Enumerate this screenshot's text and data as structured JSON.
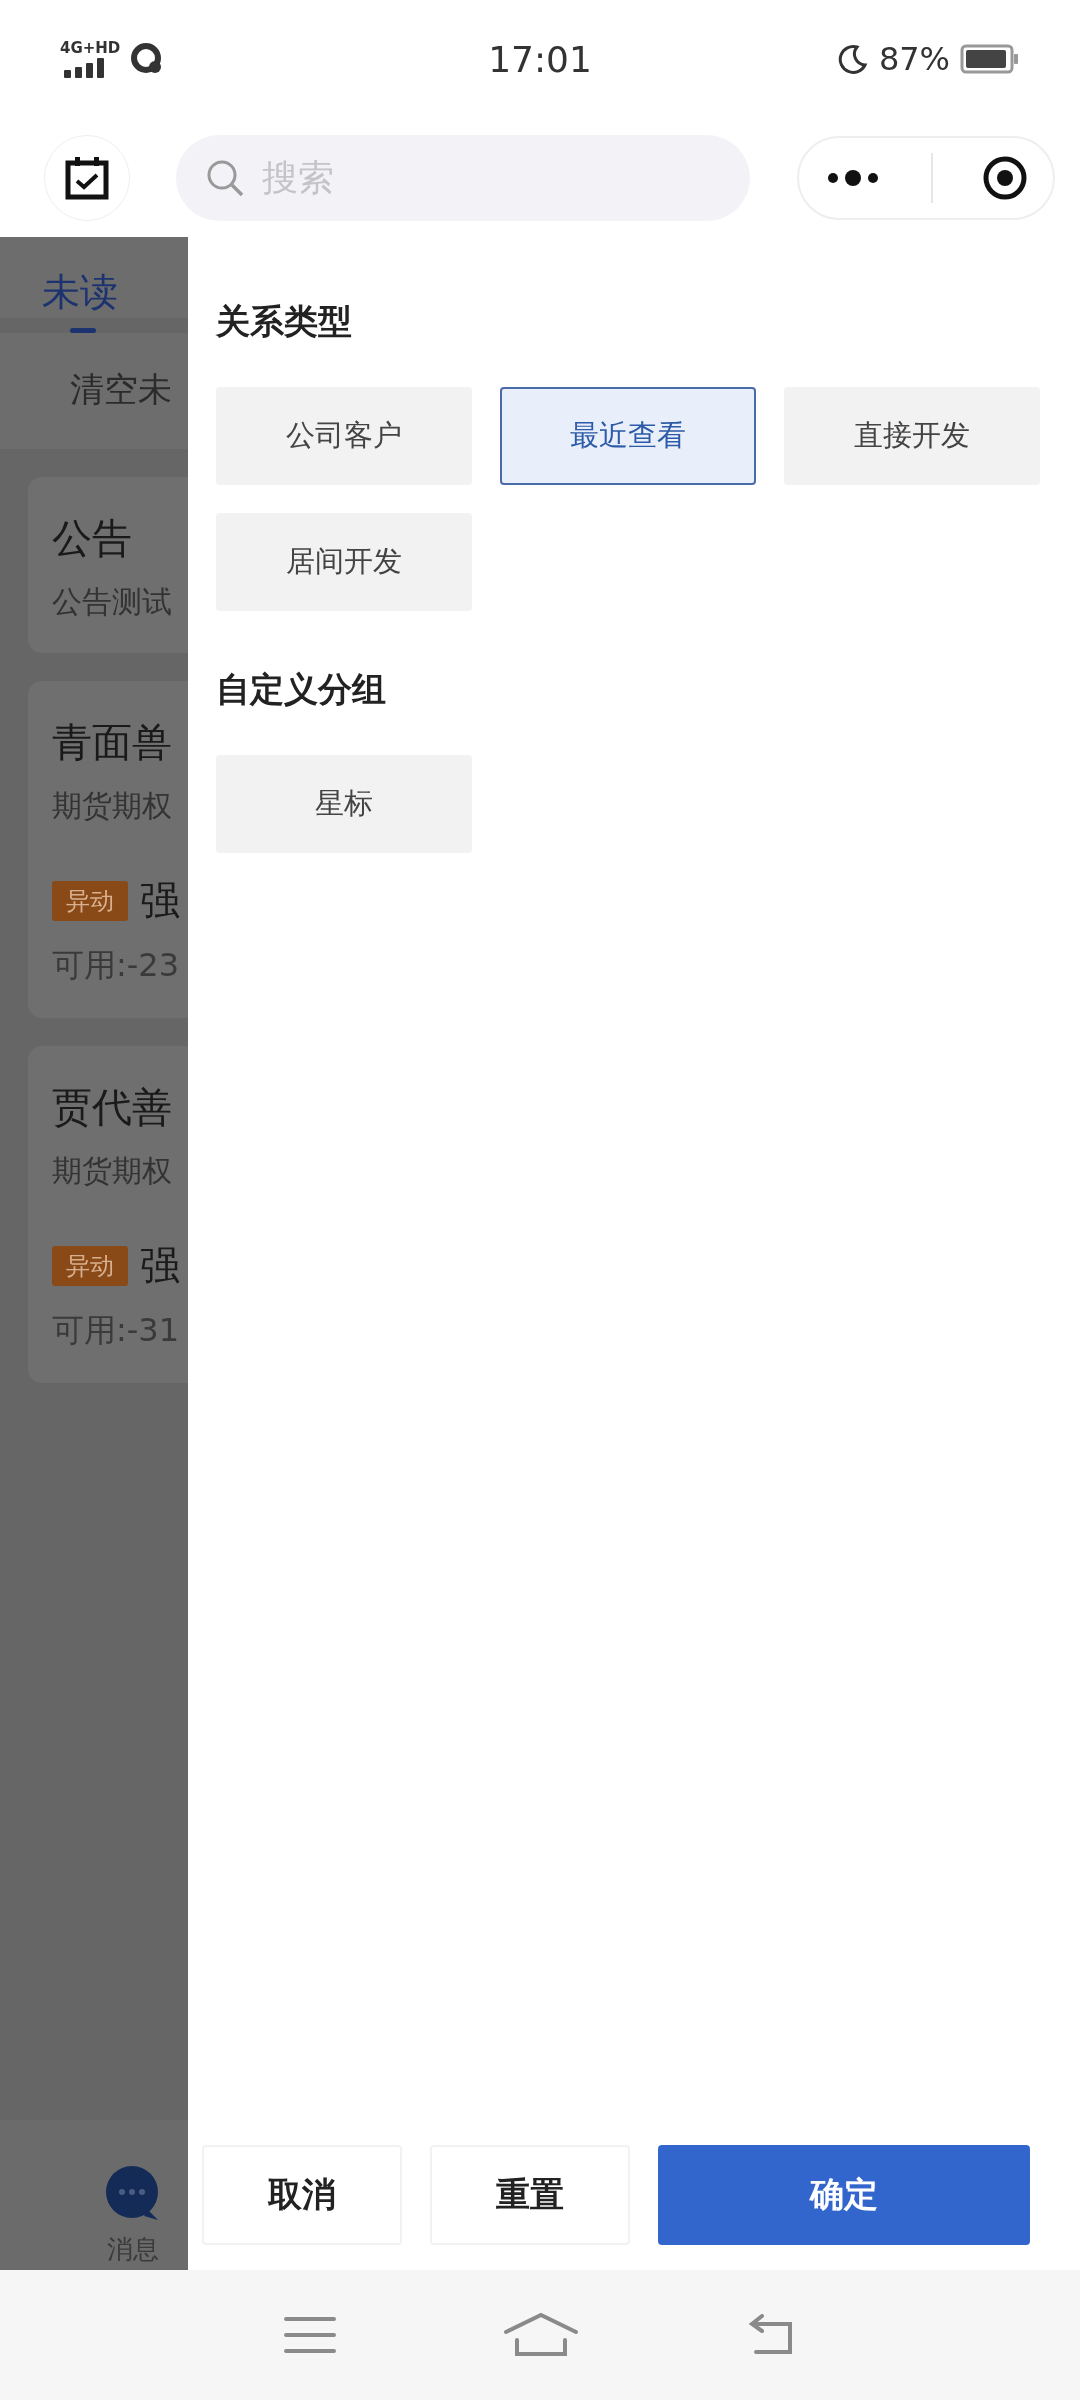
{
  "status_bar": {
    "network": "4G+HD",
    "time": "17:01",
    "battery": "87%"
  },
  "header": {
    "search": {
      "placeholder": "搜索"
    }
  },
  "background": {
    "tabs": [
      {
        "label": "未读",
        "selected": true
      }
    ],
    "clear_label": "清空未",
    "cards": [
      {
        "kind": "notice",
        "title": "公告",
        "subtitle": "公告测试"
      },
      {
        "kind": "client",
        "title": "青面兽",
        "subtitle": "期货期权",
        "tag": "异动",
        "name": "强",
        "balance": "可用:-23"
      },
      {
        "kind": "client",
        "title": "贾代善",
        "subtitle": "期货期权",
        "tag": "异动",
        "name": "强",
        "balance": "可用:-31"
      }
    ],
    "nav": [
      {
        "label": "消息"
      }
    ]
  },
  "filter": {
    "sections": [
      {
        "title": "关系类型",
        "options": [
          {
            "label": "公司客户",
            "selected": false
          },
          {
            "label": "最近查看",
            "selected": true
          },
          {
            "label": "直接开发",
            "selected": false
          },
          {
            "label": "居间开发",
            "selected": false
          }
        ]
      },
      {
        "title": "自定义分组",
        "options": [
          {
            "label": "星标",
            "selected": false
          }
        ]
      }
    ],
    "buttons": [
      {
        "label": "取消",
        "kind": "plain"
      },
      {
        "label": "重置",
        "kind": "plain"
      },
      {
        "label": "确定",
        "kind": "primary"
      }
    ]
  }
}
